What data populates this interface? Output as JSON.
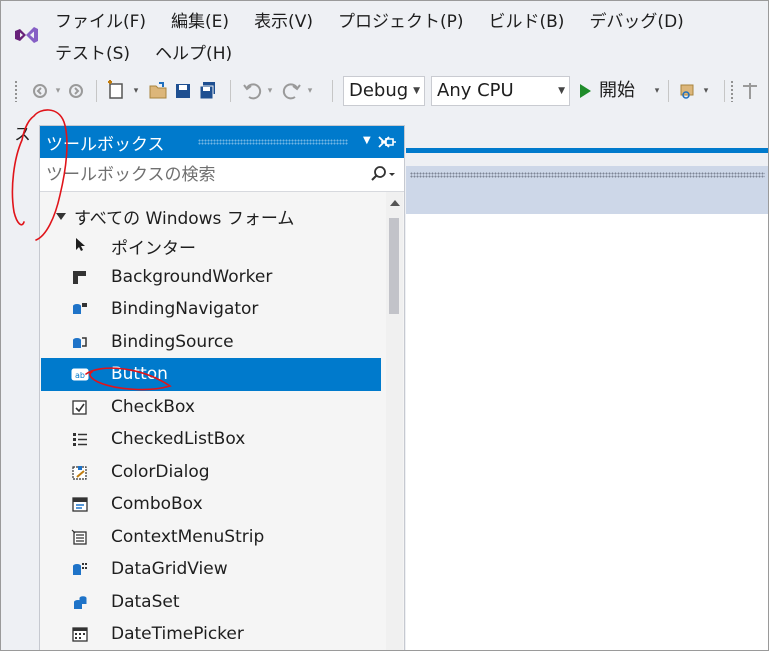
{
  "menu": {
    "items": [
      "ファイル(F)",
      "編集(E)",
      "表示(V)",
      "プロジェクト(P)",
      "ビルド(B)",
      "デバッグ(D)",
      "テスト(S)",
      "ヘルプ(H)"
    ]
  },
  "toolbar": {
    "configuration": "Debug",
    "platform": "Any CPU",
    "start_label": "開始"
  },
  "side_tab": {
    "label": "ツールボックス"
  },
  "toolbox": {
    "title": "ツールボックス",
    "search_placeholder": "ツールボックスの検索",
    "category": "すべての Windows フォーム",
    "items": [
      {
        "label": "ポインター",
        "icon": "pointer-icon"
      },
      {
        "label": "BackgroundWorker",
        "icon": "background-worker-icon"
      },
      {
        "label": "BindingNavigator",
        "icon": "binding-navigator-icon"
      },
      {
        "label": "BindingSource",
        "icon": "binding-source-icon"
      },
      {
        "label": "Button",
        "icon": "button-icon",
        "selected": true
      },
      {
        "label": "CheckBox",
        "icon": "checkbox-icon"
      },
      {
        "label": "CheckedListBox",
        "icon": "checked-list-box-icon"
      },
      {
        "label": "ColorDialog",
        "icon": "color-dialog-icon"
      },
      {
        "label": "ComboBox",
        "icon": "combobox-icon"
      },
      {
        "label": "ContextMenuStrip",
        "icon": "context-menu-strip-icon"
      },
      {
        "label": "DataGridView",
        "icon": "data-grid-view-icon"
      },
      {
        "label": "DataSet",
        "icon": "dataset-icon"
      },
      {
        "label": "DateTimePicker",
        "icon": "date-time-picker-icon"
      }
    ]
  },
  "colors": {
    "accent": "#007acc",
    "chrome_background": "#eef0f4",
    "start_green": "#1f8c2b",
    "annotation_red": "#e0141a"
  }
}
